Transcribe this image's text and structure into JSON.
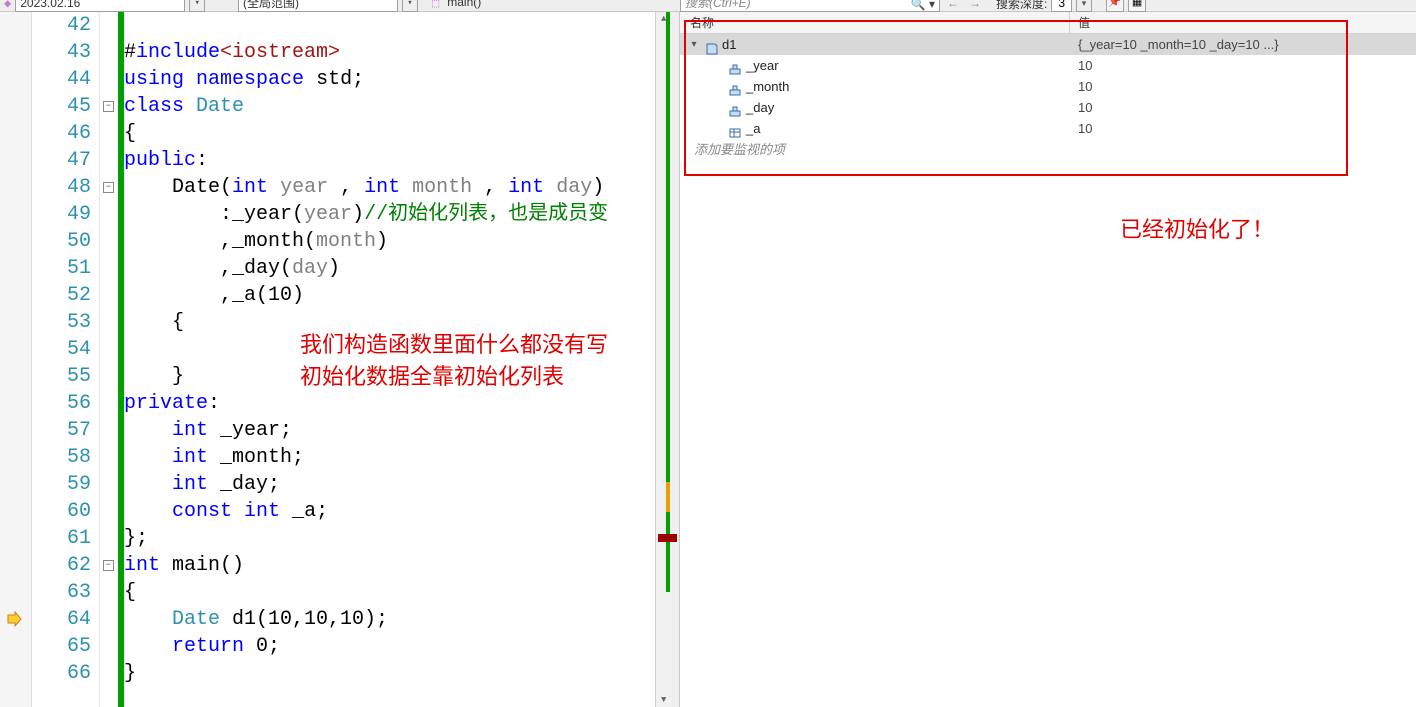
{
  "toolbar": {
    "project": "2023.02.16",
    "scope": "(全局范围)",
    "context": "main()",
    "search_placeholder": "搜索(Ctrl+E)",
    "depth_label": "搜索深度:",
    "depth_value": "3"
  },
  "editor": {
    "first_line": 42,
    "current_line": 64,
    "tokens": [
      [],
      [
        {
          "t": "ident",
          "v": "#"
        },
        {
          "t": "kw",
          "v": "include"
        },
        {
          "t": "str-pp",
          "v": "<iostream>"
        }
      ],
      [
        {
          "t": "kw",
          "v": "using"
        },
        {
          "t": "ident",
          "v": " "
        },
        {
          "t": "kw",
          "v": "namespace"
        },
        {
          "t": "ident",
          "v": " std;"
        }
      ],
      [
        {
          "t": "kw",
          "v": "class"
        },
        {
          "t": "ident",
          "v": " "
        },
        {
          "t": "typ",
          "v": "Date"
        }
      ],
      [
        {
          "t": "ident",
          "v": "{"
        }
      ],
      [
        {
          "t": "kw",
          "v": "public"
        },
        {
          "t": "ident",
          "v": ":"
        }
      ],
      [
        {
          "t": "ident",
          "v": "    "
        },
        {
          "t": "ident",
          "v": "Date("
        },
        {
          "t": "kw",
          "v": "int"
        },
        {
          "t": "ident",
          "v": " "
        },
        {
          "t": "param",
          "v": "year"
        },
        {
          "t": "ident",
          "v": " , "
        },
        {
          "t": "kw",
          "v": "int"
        },
        {
          "t": "ident",
          "v": " "
        },
        {
          "t": "param",
          "v": "month"
        },
        {
          "t": "ident",
          "v": " , "
        },
        {
          "t": "kw",
          "v": "int"
        },
        {
          "t": "ident",
          "v": " "
        },
        {
          "t": "param",
          "v": "day"
        },
        {
          "t": "ident",
          "v": ")"
        }
      ],
      [
        {
          "t": "ident",
          "v": "        :_year("
        },
        {
          "t": "param",
          "v": "year"
        },
        {
          "t": "ident",
          "v": ")"
        },
        {
          "t": "cmt",
          "v": "//初始化列表，也是成员变"
        }
      ],
      [
        {
          "t": "ident",
          "v": "        ,_month("
        },
        {
          "t": "param",
          "v": "month"
        },
        {
          "t": "ident",
          "v": ")"
        }
      ],
      [
        {
          "t": "ident",
          "v": "        ,_day("
        },
        {
          "t": "param",
          "v": "day"
        },
        {
          "t": "ident",
          "v": ")"
        }
      ],
      [
        {
          "t": "ident",
          "v": "        ,_a(10)"
        }
      ],
      [
        {
          "t": "ident",
          "v": "    {"
        }
      ],
      [],
      [
        {
          "t": "ident",
          "v": "    }"
        }
      ],
      [
        {
          "t": "kw",
          "v": "private"
        },
        {
          "t": "ident",
          "v": ":"
        }
      ],
      [
        {
          "t": "ident",
          "v": "    "
        },
        {
          "t": "kw",
          "v": "int"
        },
        {
          "t": "ident",
          "v": " _year;"
        }
      ],
      [
        {
          "t": "ident",
          "v": "    "
        },
        {
          "t": "kw",
          "v": "int"
        },
        {
          "t": "ident",
          "v": " _month;"
        }
      ],
      [
        {
          "t": "ident",
          "v": "    "
        },
        {
          "t": "kw",
          "v": "int"
        },
        {
          "t": "ident",
          "v": " _day;"
        }
      ],
      [
        {
          "t": "ident",
          "v": "    "
        },
        {
          "t": "kw",
          "v": "const"
        },
        {
          "t": "ident",
          "v": " "
        },
        {
          "t": "kw",
          "v": "int"
        },
        {
          "t": "ident",
          "v": " _a;"
        }
      ],
      [
        {
          "t": "ident",
          "v": "};"
        }
      ],
      [
        {
          "t": "kw",
          "v": "int"
        },
        {
          "t": "ident",
          "v": " main()"
        }
      ],
      [
        {
          "t": "ident",
          "v": "{"
        }
      ],
      [
        {
          "t": "ident",
          "v": "    "
        },
        {
          "t": "typ",
          "v": "Date"
        },
        {
          "t": "ident",
          "v": " d1(10,10,10);"
        }
      ],
      [
        {
          "t": "ident",
          "v": "    "
        },
        {
          "t": "kw",
          "v": "return"
        },
        {
          "t": "ident",
          "v": " 0;"
        }
      ],
      [
        {
          "t": "ident",
          "v": "}"
        }
      ]
    ],
    "fold_boxes": [
      45,
      48,
      62
    ],
    "annotation1_line1": "我们构造函数里面什么都没有写",
    "annotation1_line2": "初始化数据全靠初始化列表"
  },
  "watch": {
    "hdr_name": "名称",
    "hdr_value": "值",
    "root": {
      "name": "d1",
      "value": "{_year=10 _month=10 _day=10 ...}"
    },
    "members": [
      {
        "name": "_year",
        "value": "10"
      },
      {
        "name": "_month",
        "value": "10"
      },
      {
        "name": "_day",
        "value": "10"
      },
      {
        "name": "_a",
        "value": "10"
      }
    ],
    "add_item": "添加要监视的项",
    "annotation": "已经初始化了！"
  }
}
